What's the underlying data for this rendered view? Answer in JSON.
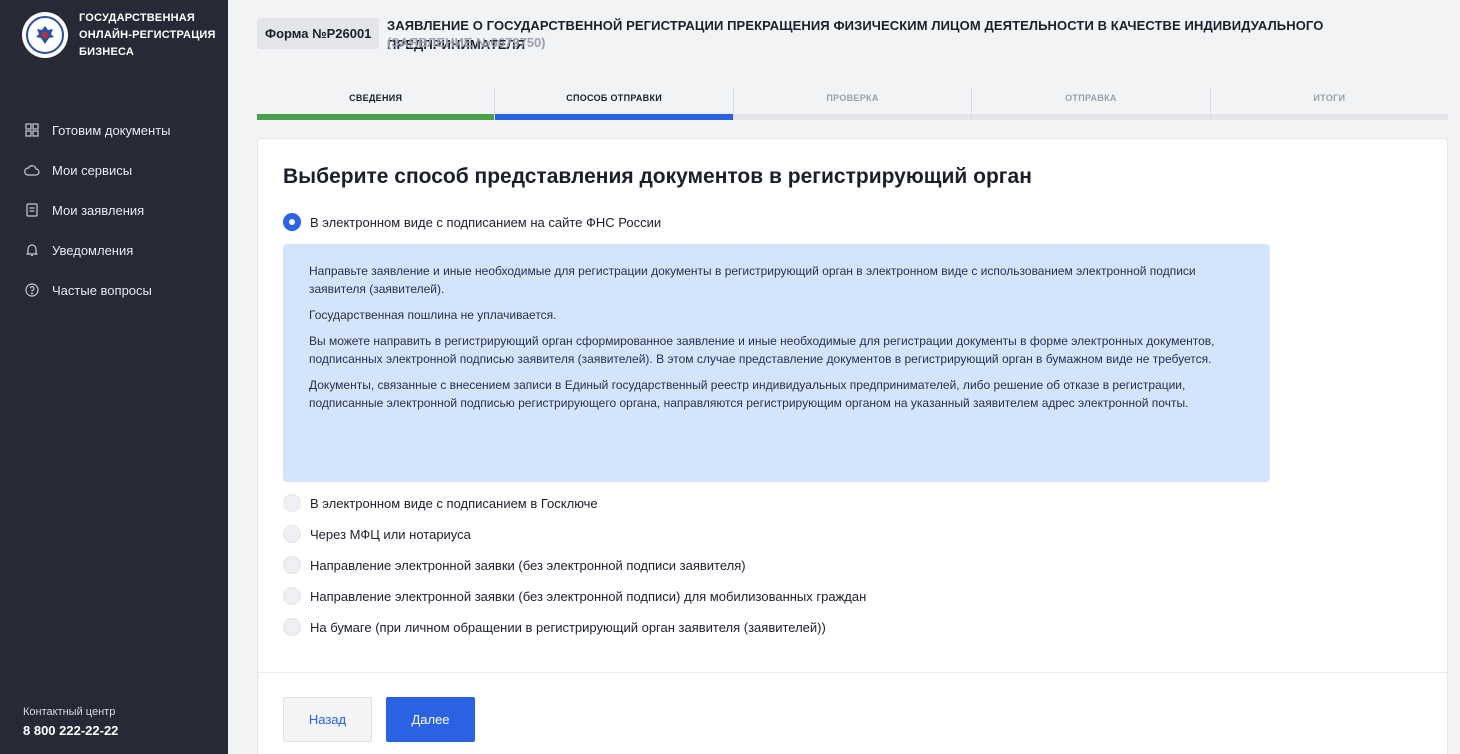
{
  "sidebar": {
    "brand_line1": "Государственная",
    "brand_line2": "онлайн-регистрация",
    "brand_line3": "бизнеса",
    "items": [
      {
        "label": "Готовим документы",
        "icon": "grid-icon"
      },
      {
        "label": "Мои сервисы",
        "icon": "cloud-icon"
      },
      {
        "label": "Мои заявления",
        "icon": "document-icon"
      },
      {
        "label": "Уведомления",
        "icon": "bell-icon"
      },
      {
        "label": "Частые вопросы",
        "icon": "question-icon"
      }
    ],
    "contact_label": "Контактный центр",
    "contact_phone": "8 800 222-22-22"
  },
  "header": {
    "form_badge": "Форма №Р26001",
    "title": "Заявление о государственной регистрации прекращения физическим лицом деятельности в качестве индивидуального предпринимателя",
    "subtitle": "(ЗАЯВЛЕНИЕ №6679750)"
  },
  "steps": [
    {
      "label": "СВЕДЕНИЯ",
      "state": "done"
    },
    {
      "label": "СПОСОБ ОТПРАВКИ",
      "state": "active"
    },
    {
      "label": "ПРОВЕРКА",
      "state": "todo"
    },
    {
      "label": "ОТПРАВКА",
      "state": "todo"
    },
    {
      "label": "ИТОГИ",
      "state": "todo"
    }
  ],
  "main": {
    "heading": "Выберите способ представления документов в регистрирующий орган",
    "options": [
      {
        "label": "В электронном виде с подписанием на сайте ФНС России",
        "selected": true
      },
      {
        "label": "В электронном виде с подписанием в Госключе",
        "selected": false
      },
      {
        "label": "Через МФЦ или нотариуса",
        "selected": false
      },
      {
        "label": "Направление электронной заявки (без электронной подписи заявителя)",
        "selected": false
      },
      {
        "label": "Направление электронной заявки (без электронной подписи) для мобилизованных граждан",
        "selected": false
      },
      {
        "label": "На бумаге (при личном обращении в регистрирующий орган заявителя (заявителей))",
        "selected": false
      }
    ],
    "info_paragraphs": [
      "Направьте заявление и иные необходимые для регистрации документы в регистрирующий орган в электронном виде с использованием электронной подписи заявителя (заявителей).",
      "Государственная пошлина не уплачивается.",
      "Вы можете направить в регистрирующий орган сформированное заявление и иные необходимые для регистрации документы в форме электронных документов, подписанных электронной подписью заявителя (заявителей). В этом случае представление документов в регистрирующий орган в бумажном виде не требуется.",
      "Документы, связанные с внесением записи в Единый государственный реестр индивидуальных предпринимателей, либо решение об отказе в регистрации, подписанные электронной подписью регистрирующего органа, направляются регистрирующим органом на указанный заявителем адрес электронной почты."
    ],
    "back_label": "Назад",
    "next_label": "Далее"
  },
  "colors": {
    "accent": "#2b62e3",
    "success": "#4aa14a",
    "sidebar_bg": "#262a36",
    "info_bg": "#d3e4fb"
  }
}
